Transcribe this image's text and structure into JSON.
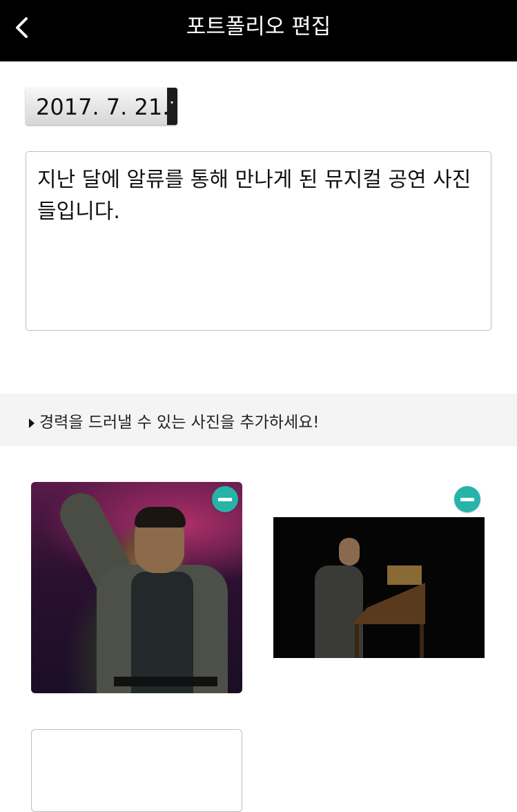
{
  "header": {
    "title": "포트폴리오 편집",
    "back_icon": "chevron-left-icon"
  },
  "form": {
    "date": "2017. 7. 21.",
    "description": "지난 달에 알류를 통해 만나게 된 뮤지컬 공연 사진 들입니다."
  },
  "hint": {
    "text": "경력을 드러낼 수 있는 사진을 추가하세요!",
    "icon": "triangle-right-icon"
  },
  "photos": [
    {
      "remove_icon": "minus-circle-icon"
    },
    {
      "remove_icon": "minus-circle-icon"
    }
  ],
  "colors": {
    "header_bg": "#000000",
    "accent": "#26b3a9",
    "hint_bg": "#f4f4f4"
  }
}
